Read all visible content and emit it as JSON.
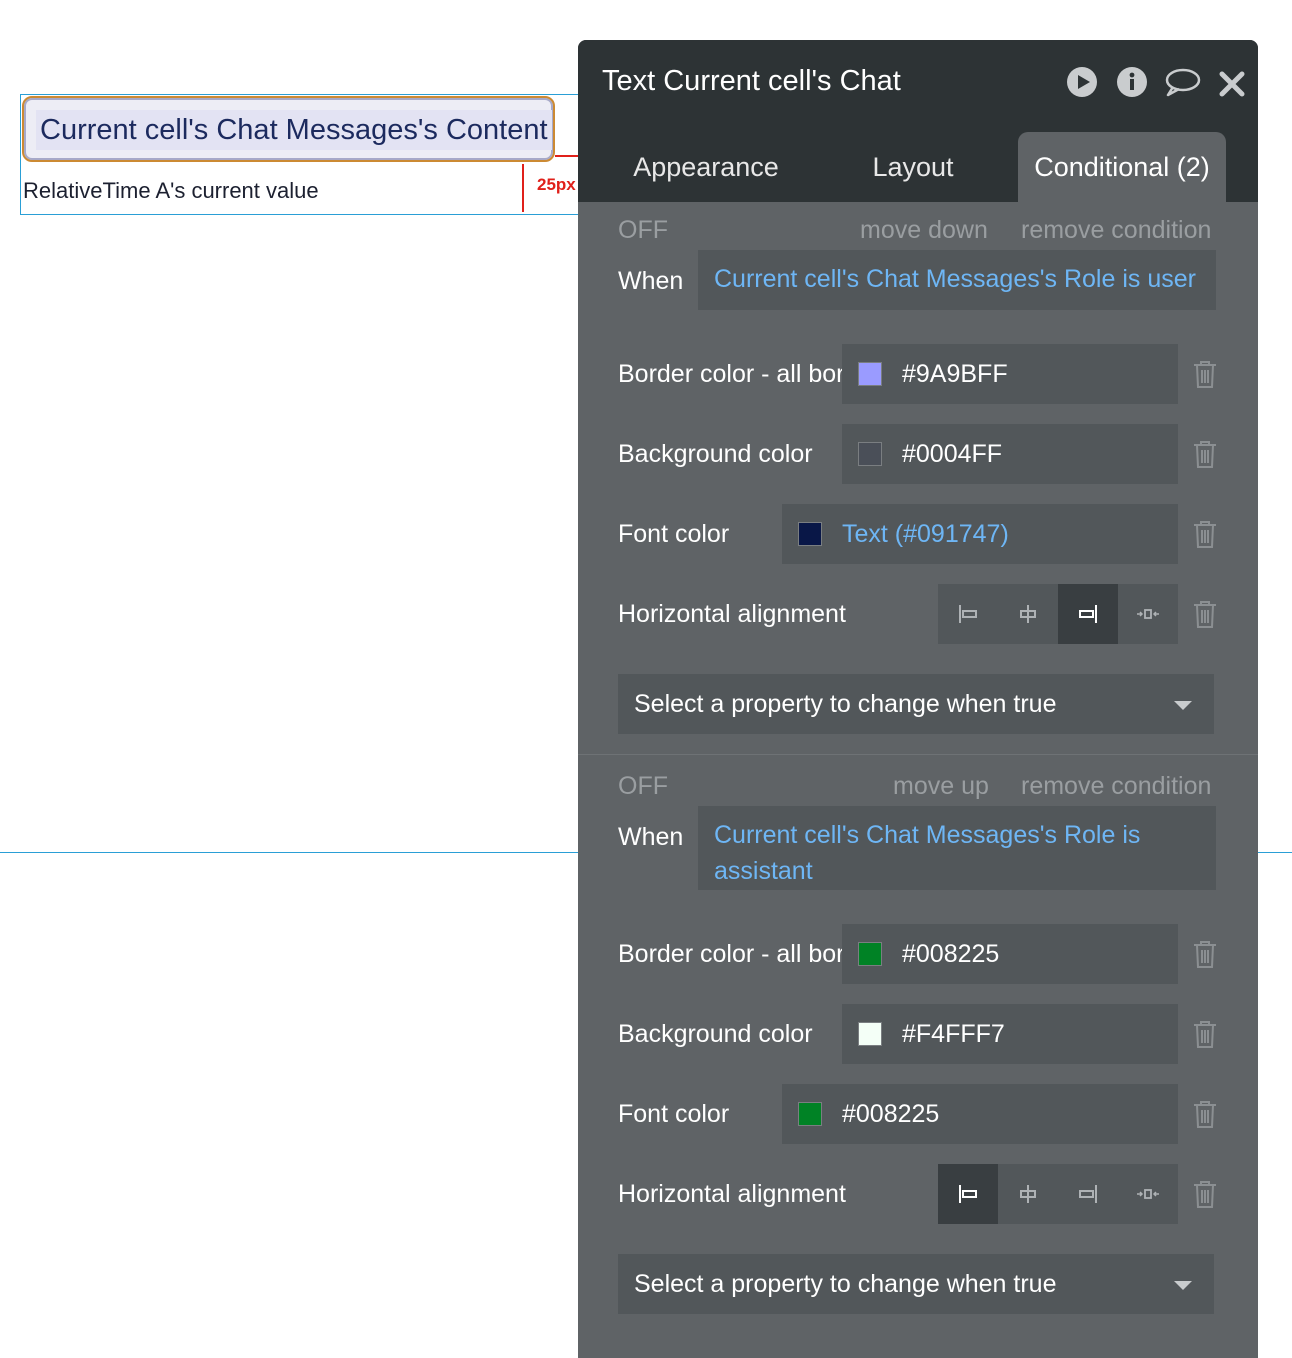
{
  "canvas": {
    "message_text": "Current cell's Chat Messages's Content",
    "time_text": "RelativeTime A's current value",
    "spacing_label": "25px"
  },
  "panel": {
    "title": "Text Current cell's Chat",
    "header_icons": [
      "play-icon",
      "info-icon",
      "comment-icon",
      "close-icon"
    ],
    "tabs": [
      {
        "label": "Appearance",
        "active": false
      },
      {
        "label": "Layout",
        "active": false
      },
      {
        "label": "Conditional (2)",
        "active": true
      }
    ],
    "conditions": [
      {
        "status": "OFF",
        "move_label": "move down",
        "remove_label": "remove condition",
        "when_label": "When",
        "when_expr": "Current cell's Chat Messages's Role is user",
        "border": {
          "label": "Border color - all borders",
          "value": "#9A9BFF",
          "swatch": "#9A9BFF"
        },
        "background": {
          "label": "Background color",
          "value": "#0004FF",
          "swatch": "#4a4f58"
        },
        "font": {
          "label": "Font color",
          "value": "Text (#091747)",
          "swatch": "#091747"
        },
        "alignment": {
          "label": "Horizontal alignment",
          "selected": "right"
        },
        "select_placeholder": "Select a property to change when true"
      },
      {
        "status": "OFF",
        "move_label": "move up",
        "remove_label": "remove condition",
        "when_label": "When",
        "when_expr": "Current cell's Chat Messages's Role is assistant",
        "border": {
          "label": "Border color - all borders",
          "value": "#008225",
          "swatch": "#008225"
        },
        "background": {
          "label": "Background color",
          "value": "#F4FFF7",
          "swatch": "#F4FFF7"
        },
        "font": {
          "label": "Font color",
          "value": "#008225",
          "swatch": "#008225"
        },
        "alignment": {
          "label": "Horizontal alignment",
          "selected": "left"
        },
        "select_placeholder": "Select a property to change when true"
      }
    ]
  },
  "colors": {
    "panel_bg": "#5f6366",
    "header_bg": "#2d3335",
    "link_blue": "#6eb6f5",
    "guide_blue": "#2a9fd6",
    "guide_red": "#e0201a"
  }
}
